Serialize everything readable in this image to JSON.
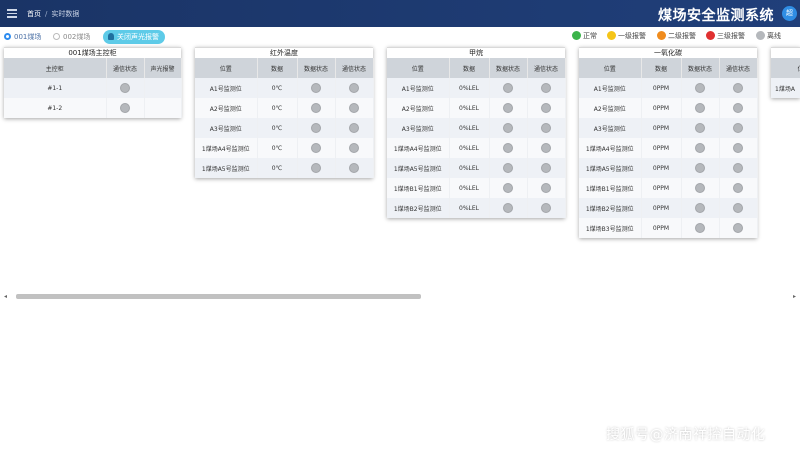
{
  "header": {
    "breadcrumb_home": "首页",
    "breadcrumb_sep": "/",
    "breadcrumb_current": "实时数据",
    "app_title": "煤场安全监测系统",
    "avatar_text": "超"
  },
  "toolbar": {
    "site_options": [
      "001煤场",
      "002煤场"
    ],
    "selected_site": "001煤场",
    "alarm_button_label": "关闭声光报警",
    "legend": [
      {
        "label": "正常",
        "color": "#3cb44b"
      },
      {
        "label": "一级报警",
        "color": "#f5c518"
      },
      {
        "label": "二级报警",
        "color": "#f08c1e"
      },
      {
        "label": "三级报警",
        "color": "#e03131"
      },
      {
        "label": "离线",
        "color": "#b5b8bc"
      }
    ]
  },
  "panels": {
    "main_control": {
      "title": "001煤场主控柜",
      "headers": [
        "主控柜",
        "通信状态",
        "声光报警"
      ],
      "rows": [
        {
          "name": "#1-1"
        },
        {
          "name": "#1-2"
        }
      ]
    },
    "infrared_temp": {
      "title": "红外温度",
      "headers": [
        "位置",
        "数据",
        "数据状态",
        "通信状态"
      ],
      "rows": [
        {
          "pos": "A1号监测位",
          "val": "0℃"
        },
        {
          "pos": "A2号监测位",
          "val": "0℃"
        },
        {
          "pos": "A3号监测位",
          "val": "0℃"
        },
        {
          "pos": "1煤场A4号监测位",
          "val": "0℃"
        },
        {
          "pos": "1煤场A5号监测位",
          "val": "0℃"
        }
      ]
    },
    "methane": {
      "title": "甲烷",
      "headers": [
        "位置",
        "数据",
        "数据状态",
        "通信状态"
      ],
      "rows": [
        {
          "pos": "A1号监测位",
          "val": "0%LEL"
        },
        {
          "pos": "A2号监测位",
          "val": "0%LEL"
        },
        {
          "pos": "A3号监测位",
          "val": "0%LEL"
        },
        {
          "pos": "1煤场A4号监测位",
          "val": "0%LEL"
        },
        {
          "pos": "1煤场A5号监测位",
          "val": "0%LEL"
        },
        {
          "pos": "1煤场B1号监测位",
          "val": "0%LEL"
        },
        {
          "pos": "1煤场B2号监测位",
          "val": "0%LEL"
        }
      ]
    },
    "co": {
      "title": "一氧化碳",
      "headers": [
        "位置",
        "数据",
        "数据状态",
        "通信状态"
      ],
      "rows": [
        {
          "pos": "A1号监测位",
          "val": "0PPM"
        },
        {
          "pos": "A2号监测位",
          "val": "0PPM"
        },
        {
          "pos": "A3号监测位",
          "val": "0PPM"
        },
        {
          "pos": "1煤场A4号监测位",
          "val": "0PPM"
        },
        {
          "pos": "1煤场A5号监测位",
          "val": "0PPM"
        },
        {
          "pos": "1煤场B1号监测位",
          "val": "0PPM"
        },
        {
          "pos": "1煤场B2号监测位",
          "val": "0PPM"
        },
        {
          "pos": "1煤场B3号监测位",
          "val": "0PPM"
        }
      ]
    },
    "partial": {
      "headers": [
        "位"
      ],
      "rows": [
        {
          "pos": "1煤场A"
        }
      ]
    }
  },
  "watermark": "搜狐号@济南祥控自动化"
}
